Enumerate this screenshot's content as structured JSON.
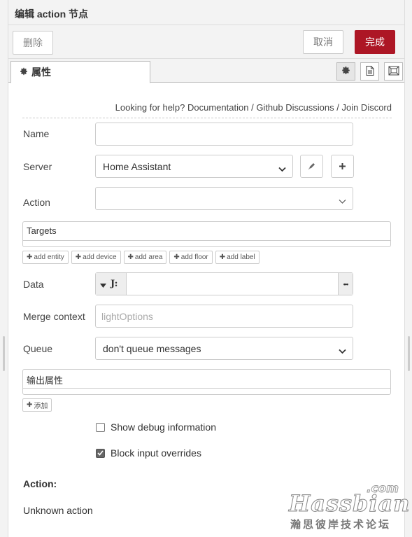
{
  "header": {
    "title": "编辑 action 节点"
  },
  "toolbar": {
    "delete_label": "删除",
    "cancel_label": "取消",
    "done_label": "完成"
  },
  "tabs": {
    "properties_label": "属性"
  },
  "help": {
    "prefix": "Looking for help?",
    "links": [
      "Documentation",
      "Github Discussions",
      "Join Discord"
    ],
    "separator": "/"
  },
  "form": {
    "name_label": "Name",
    "name_value": "",
    "server_label": "Server",
    "server_value": "Home Assistant",
    "action_label": "Action",
    "action_value": "",
    "targets_label": "Targets",
    "target_chips": [
      "add entity",
      "add device",
      "add area",
      "add floor",
      "add label"
    ],
    "data_label": "Data",
    "data_type_glyph": "J:",
    "data_expand_glyph": "•••",
    "merge_label": "Merge context",
    "merge_placeholder": "lightOptions",
    "queue_label": "Queue",
    "queue_value": "don't queue messages",
    "outputs_label": "输出属性",
    "add_output_label": "添加",
    "show_debug_label": "Show debug information",
    "show_debug_checked": false,
    "block_overrides_label": "Block input overrides",
    "block_overrides_checked": true
  },
  "action_section": {
    "title": "Action:",
    "text": "Unknown action"
  },
  "watermark": {
    "com": ".com",
    "brand": "Hassbian",
    "subtitle": "瀚思彼岸技术论坛"
  },
  "colors": {
    "primary": "#ad1625",
    "border": "#cccccc",
    "panel": "#f3f3f3"
  }
}
